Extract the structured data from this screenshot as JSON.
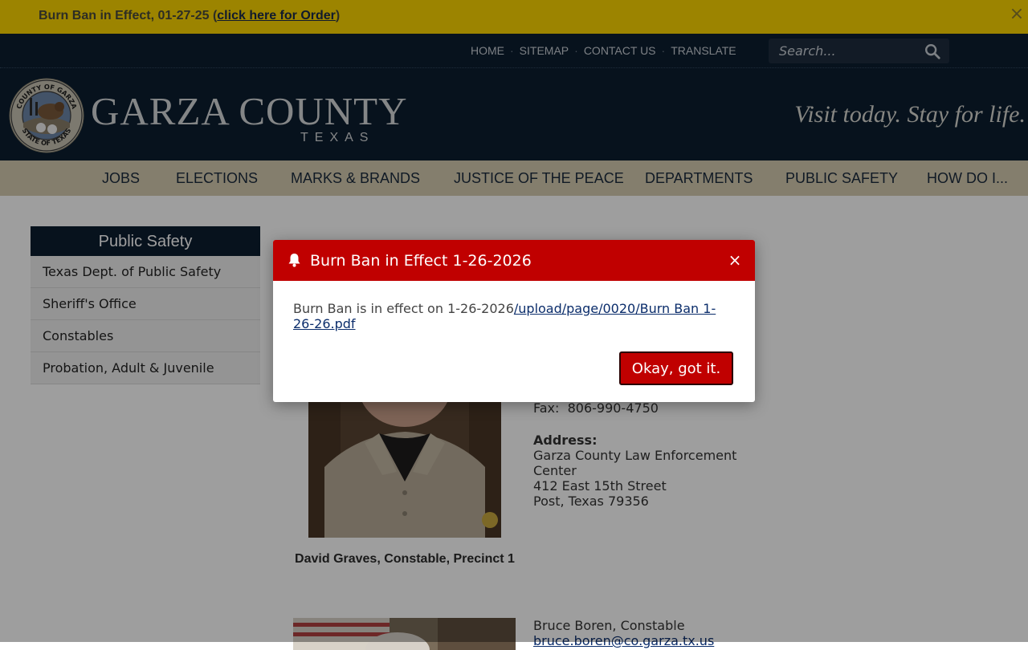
{
  "alert_bar": {
    "text": "Burn Ban in Effect, 01-27-25 (",
    "link_text": "click here for Order",
    "close_paren": ")",
    "close_symbol": "×"
  },
  "header": {
    "utility_nav": [
      "HOME",
      "SITEMAP",
      "CONTACT US",
      "TRANSLATE"
    ],
    "search_placeholder": "Search...",
    "logo_title": "GARZA COUNTY",
    "logo_subtitle": "TEXAS",
    "seal_top": "COUNTY OF GARZA",
    "seal_bottom": "STATE OF TEXAS",
    "tagline": "Visit today. Stay for life."
  },
  "main_nav": [
    "JOBS",
    "ELECTIONS",
    "MARKS & BRANDS",
    "JUSTICE OF THE PEACE",
    "DEPARTMENTS",
    "PUBLIC SAFETY",
    "HOW DO I..."
  ],
  "sidebar": {
    "title": "Public Safety",
    "items": [
      "Texas Dept. of Public Safety",
      "Sheriff's Office",
      "Constables",
      "Probation, Adult & Juvenile"
    ]
  },
  "constable1": {
    "caption": "David Graves, Constable, Precinct 1",
    "fax_label": "Fax:",
    "fax": "806-990-4750",
    "address_label": "Address:",
    "address_lines": [
      "Garza County Law Enforcement",
      "Center",
      "412 East 15th Street",
      "Post, Texas  79356"
    ]
  },
  "constable2": {
    "name": "Bruce Boren, Constable",
    "email": "bruce.boren@co.garza.tx.us"
  },
  "modal": {
    "title": "Burn Ban in Effect 1-26-2026",
    "body_text": "Burn Ban is in effect on 1-26-2026",
    "link_text": "/upload/page/0020/Burn Ban 1-26-26.pdf",
    "button_label": "Okay, got it.",
    "close_symbol": "×"
  },
  "colors": {
    "alert_bar": "#fcd600",
    "header_bg": "#0c1d30",
    "nav_bg": "#d5cbb1",
    "modal_accent": "#c00000"
  }
}
